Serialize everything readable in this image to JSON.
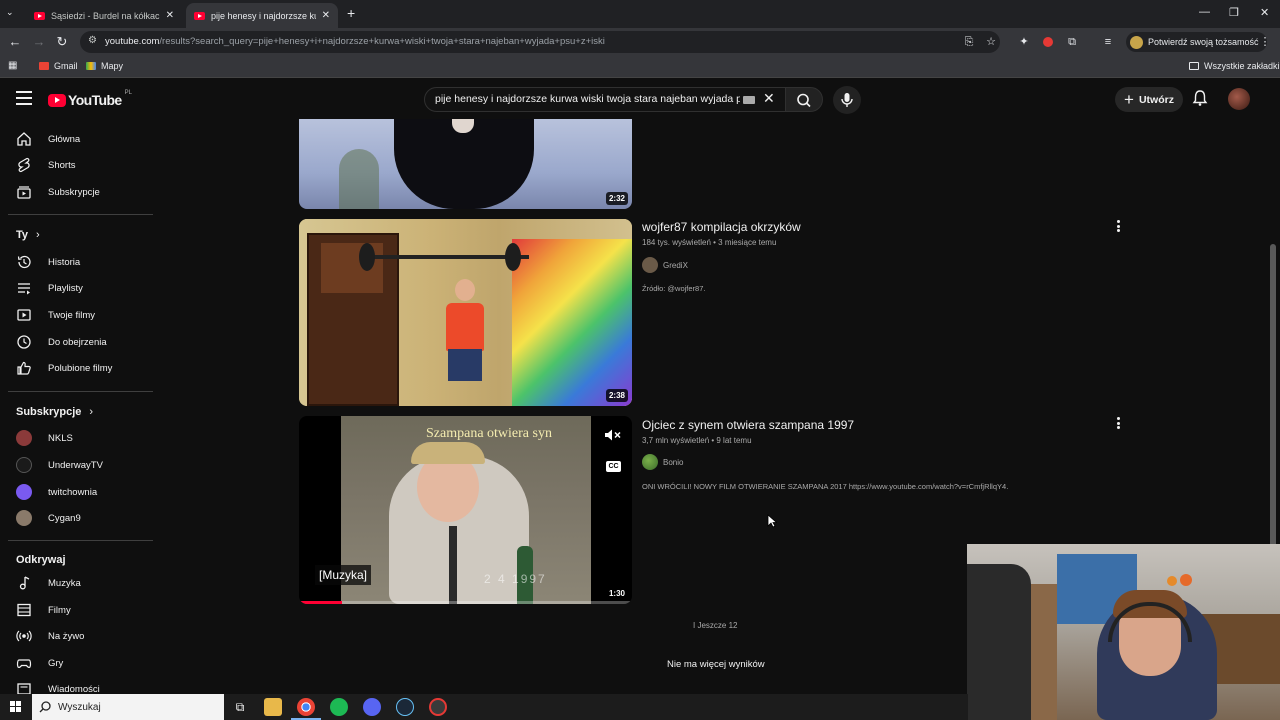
{
  "browser": {
    "tabs": [
      {
        "label": "Sąsiedzi - Burdel na kółkach [P",
        "active": false
      },
      {
        "label": "pije henesy i najdorzsze kurwa",
        "active": true
      }
    ],
    "url": "youtube.com/results?search_query=pije+henesy+i+najdorzsze+kurwa+wiski+twoja+stara+najeban+wyjada+psu+z+iski",
    "url_host": "youtube.com",
    "url_path": "/results?search_query=pije+henesy+i+najdorzsze+kurwa+wiski+twoja+stara+najeban+wyjada+psu+z+iski",
    "profile_label": "Potwierdź swoją tożsamość",
    "bookmarks": [
      {
        "label": "Gmail"
      },
      {
        "label": "Mapy"
      }
    ],
    "all_bookmarks": "Wszystkie zakładki"
  },
  "youtube": {
    "logo_text": "YouTube",
    "logo_country": "PL",
    "search_value": "pije henesy i najdorzsze kurwa wiski twoja stara najeban wyjada psu z iski",
    "create_label": "Utwórz"
  },
  "sidebar": {
    "main": [
      {
        "label": "Główna",
        "icon": "home-icon"
      },
      {
        "label": "Shorts",
        "icon": "shorts-icon"
      },
      {
        "label": "Subskrypcje",
        "icon": "subscriptions-icon"
      }
    ],
    "you_header": "Ty",
    "you": [
      {
        "label": "Historia",
        "icon": "history-icon"
      },
      {
        "label": "Playlisty",
        "icon": "playlists-icon"
      },
      {
        "label": "Twoje filmy",
        "icon": "your-videos-icon"
      },
      {
        "label": "Do obejrzenia",
        "icon": "watch-later-icon"
      },
      {
        "label": "Polubione filmy",
        "icon": "liked-icon"
      }
    ],
    "subs_header": "Subskrypcje",
    "subs": [
      {
        "label": "NKLS",
        "color": "#8b3a3a"
      },
      {
        "label": "UnderwayTV",
        "color": "#1a1a1a"
      },
      {
        "label": "twitchownia",
        "color": "#7a5af0"
      },
      {
        "label": "Cygan9",
        "color": "#8a7a6a"
      }
    ],
    "explore_header": "Odkrywaj",
    "explore": [
      {
        "label": "Muzyka",
        "icon": "music-icon"
      },
      {
        "label": "Filmy",
        "icon": "movies-icon"
      },
      {
        "label": "Na żywo",
        "icon": "live-icon"
      },
      {
        "label": "Gry",
        "icon": "gaming-icon"
      },
      {
        "label": "Wiadomości",
        "icon": "news-icon"
      }
    ]
  },
  "results": [
    {
      "duration": "2:32"
    },
    {
      "title": "wojfer87 kompilacja okrzyków",
      "meta": "184 tys. wyświetleń • 3 miesiące temu",
      "channel": "GrediX",
      "description": "Źródło: @wojfer87.",
      "duration": "2:38"
    },
    {
      "title": "Ojciec z synem otwiera szampana 1997",
      "meta": "3,7 mln wyświetleń • 9 lat temu",
      "channel": "Bonio",
      "description": "ONI WRÓCILI! NOWY FILM OTWIERANIE SZAMPANA 2017 https://www.youtube.com/watch?v=rCmfjRllqY4.",
      "duration": "1:30",
      "overlay_text": "Szampana otwiera syn",
      "caption": "[Muzyka]",
      "date_stamp": "2 4 1997",
      "progress": 0.13
    }
  ],
  "footer": {
    "more": "I Jeszcze 12",
    "no_more": "Nie ma więcej wyników"
  },
  "taskbar": {
    "search_placeholder": "Wyszukaj"
  }
}
